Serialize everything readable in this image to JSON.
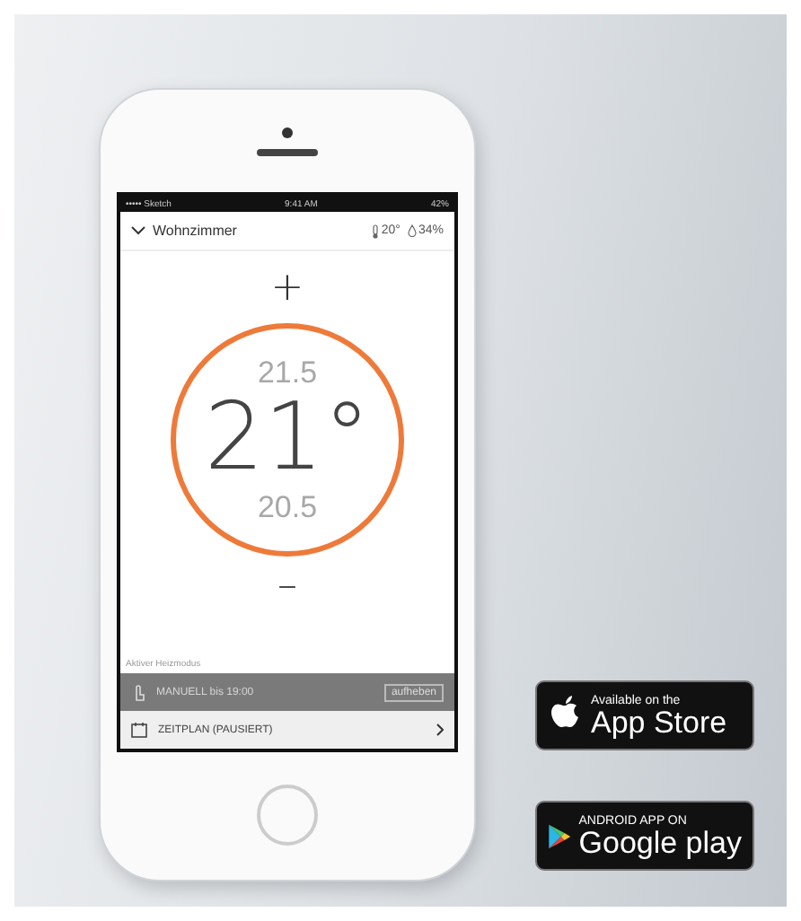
{
  "status_bar": {
    "carrier": "••••• Sketch",
    "time": "9:41 AM",
    "battery": "42%"
  },
  "header": {
    "room": "Wohnzimmer",
    "temperature": "20°",
    "humidity": "34%"
  },
  "thermostat": {
    "increase": "+",
    "above": "21.5",
    "current": "21°",
    "below": "20.5",
    "decrease": "–"
  },
  "mode_section": {
    "label": "Aktiver Heizmodus",
    "modes": [
      {
        "kind": "manual",
        "label": "MANUELL bis 19:00",
        "action": "aufheben",
        "selected": true
      },
      {
        "kind": "schedule",
        "label": "ZEITPLAN (PAUSIERT)",
        "selected": false
      }
    ]
  },
  "store_badges": [
    {
      "kind": "apple",
      "small": "Available on the",
      "large": "App Store"
    },
    {
      "kind": "google",
      "small": "ANDROID APP ON",
      "large": "Google play"
    }
  ]
}
